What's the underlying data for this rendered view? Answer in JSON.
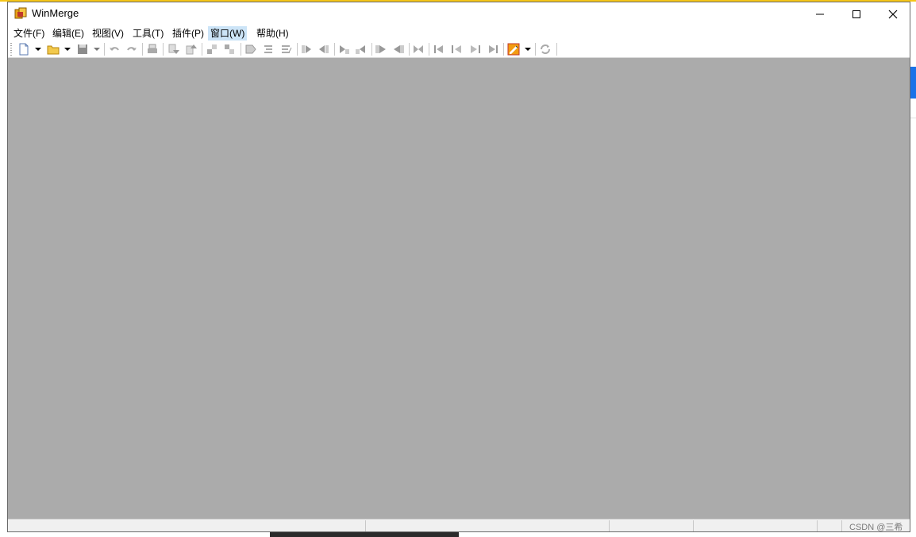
{
  "window": {
    "title": "WinMerge",
    "app_icon": "winmerge-logo-icon",
    "controls": [
      "minimize-icon",
      "maximize-icon",
      "close-icon"
    ]
  },
  "menu": [
    {
      "label": "文件(F)"
    },
    {
      "label": "编辑(E)"
    },
    {
      "label": "视图(V)"
    },
    {
      "label": "工具(T)"
    },
    {
      "label": "插件(P)"
    },
    {
      "label": "窗口(W)",
      "active": true
    },
    {
      "label": "帮助(H)"
    }
  ],
  "toolbar": {
    "buttons": [
      "new-document-icon",
      "open-folder-icon",
      "save-icon",
      "undo-icon",
      "redo-icon",
      "print-icon",
      "next-diff-icon",
      "prev-diff-icon",
      "first-diff-icon",
      "last-diff-icon",
      "current-diff-icon",
      "next-conflict-icon",
      "prev-conflict-icon",
      "copy-to-right-icon",
      "copy-to-left-icon",
      "copy-right-advance-icon",
      "copy-left-advance-icon",
      "copy-all-right-icon",
      "copy-all-left-icon",
      "merge-icon",
      "first-file-icon",
      "prev-file-icon",
      "next-file-icon",
      "last-file-icon",
      "options-icon",
      "refresh-icon"
    ],
    "state": "mostly-disabled"
  },
  "statusbar": {
    "watermark": "CSDN @三希"
  },
  "colors": {
    "client_bg": "#ababab",
    "active_menu_bg": "#cce4f7",
    "titlebar_bg": "#ffffff"
  }
}
